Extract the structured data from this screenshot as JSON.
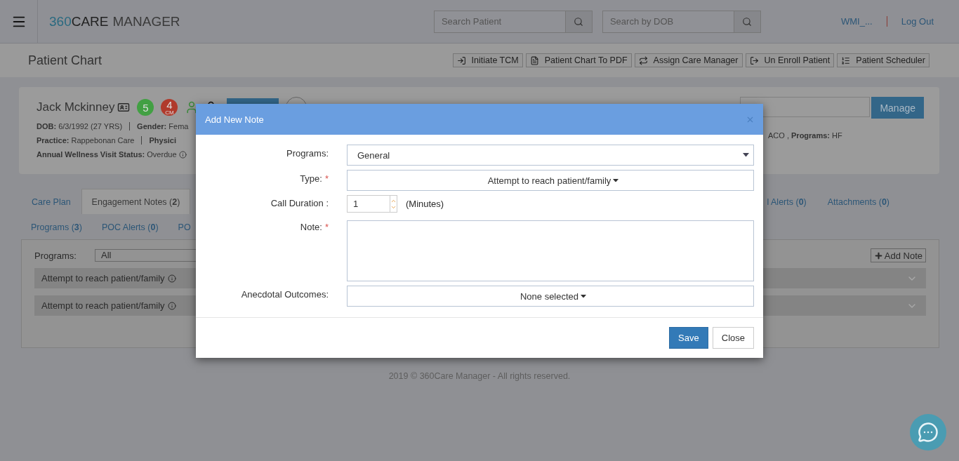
{
  "header": {
    "brand": [
      "360",
      "CARE",
      "MANAGER"
    ],
    "search_patient": {
      "placeholder": "Search Patient"
    },
    "search_dob": {
      "placeholder": "Search by DOB"
    },
    "user": "WMI_...",
    "logout": "Log Out"
  },
  "subheader": {
    "title": "Patient Chart",
    "actions": [
      "Initiate TCM",
      "Patient Chart To PDF",
      "Assign Care Manager",
      "Un Enroll Patient",
      "Patient Scheduler"
    ]
  },
  "patient": {
    "name": "Jack Mckinney",
    "badges": [
      {
        "text": "5",
        "color": "#42a043"
      },
      {
        "text": "4",
        "sub": "CM",
        "color": "#b03a2c"
      }
    ],
    "lines": [
      [
        "**DOB:** 6/3/1992 (27 YRS)",
        "**Gender:** Fema"
      ],
      [
        "**Practice:** Rappebonan Care",
        "**Physici**"
      ],
      [
        "**Annual Wellness Visit Status:** Overdue"
      ]
    ],
    "right_line": "ACO , **Programs:** HF",
    "manage": "Manage"
  },
  "tabs": [
    [
      {
        "label": "Care Plan",
        "selected": false
      },
      {
        "label": "Engagement Notes (**2**)",
        "selected": true
      }
    ],
    [
      {
        "label": "Programs (**3**)",
        "selected": false
      },
      {
        "label": "POC Alerts (**0**)",
        "selected": false
      },
      {
        "label": "PO",
        "selected": false
      }
    ]
  ],
  "tabs_right": [
    {
      "label": "l Alerts (**0**)",
      "selected": false
    },
    {
      "label": "Attachments (**0**)",
      "selected": false
    }
  ],
  "notes": {
    "filter_label": "Programs:",
    "filter_value": "All",
    "add_note": "Add Note",
    "items": [
      {
        "title": "Attempt to reach patient/family",
        "expanded": false
      },
      {
        "title": "Attempt to reach patient/family",
        "expanded": false
      }
    ]
  },
  "footer": "2019 © 360Care Manager - All rights reserved.",
  "modal": {
    "title": "Add New Note",
    "fields": [
      {
        "kind": "select",
        "label": "Programs:",
        "value": "General"
      },
      {
        "kind": "dropdown",
        "label": "Type:",
        "required_mark": "*",
        "value": "Attempt to reach patient/family"
      },
      {
        "kind": "number",
        "label": "Call Duration :",
        "value": "1",
        "unit": "(Minutes)"
      },
      {
        "kind": "textarea",
        "label": "Note:",
        "required_mark": "*"
      },
      {
        "kind": "dropdown",
        "label": "Anecdotal Outcomes:",
        "value": "None selected"
      }
    ],
    "buttons": [
      {
        "label": "Save",
        "primary": true
      },
      {
        "label": "Close",
        "primary": false
      }
    ]
  }
}
